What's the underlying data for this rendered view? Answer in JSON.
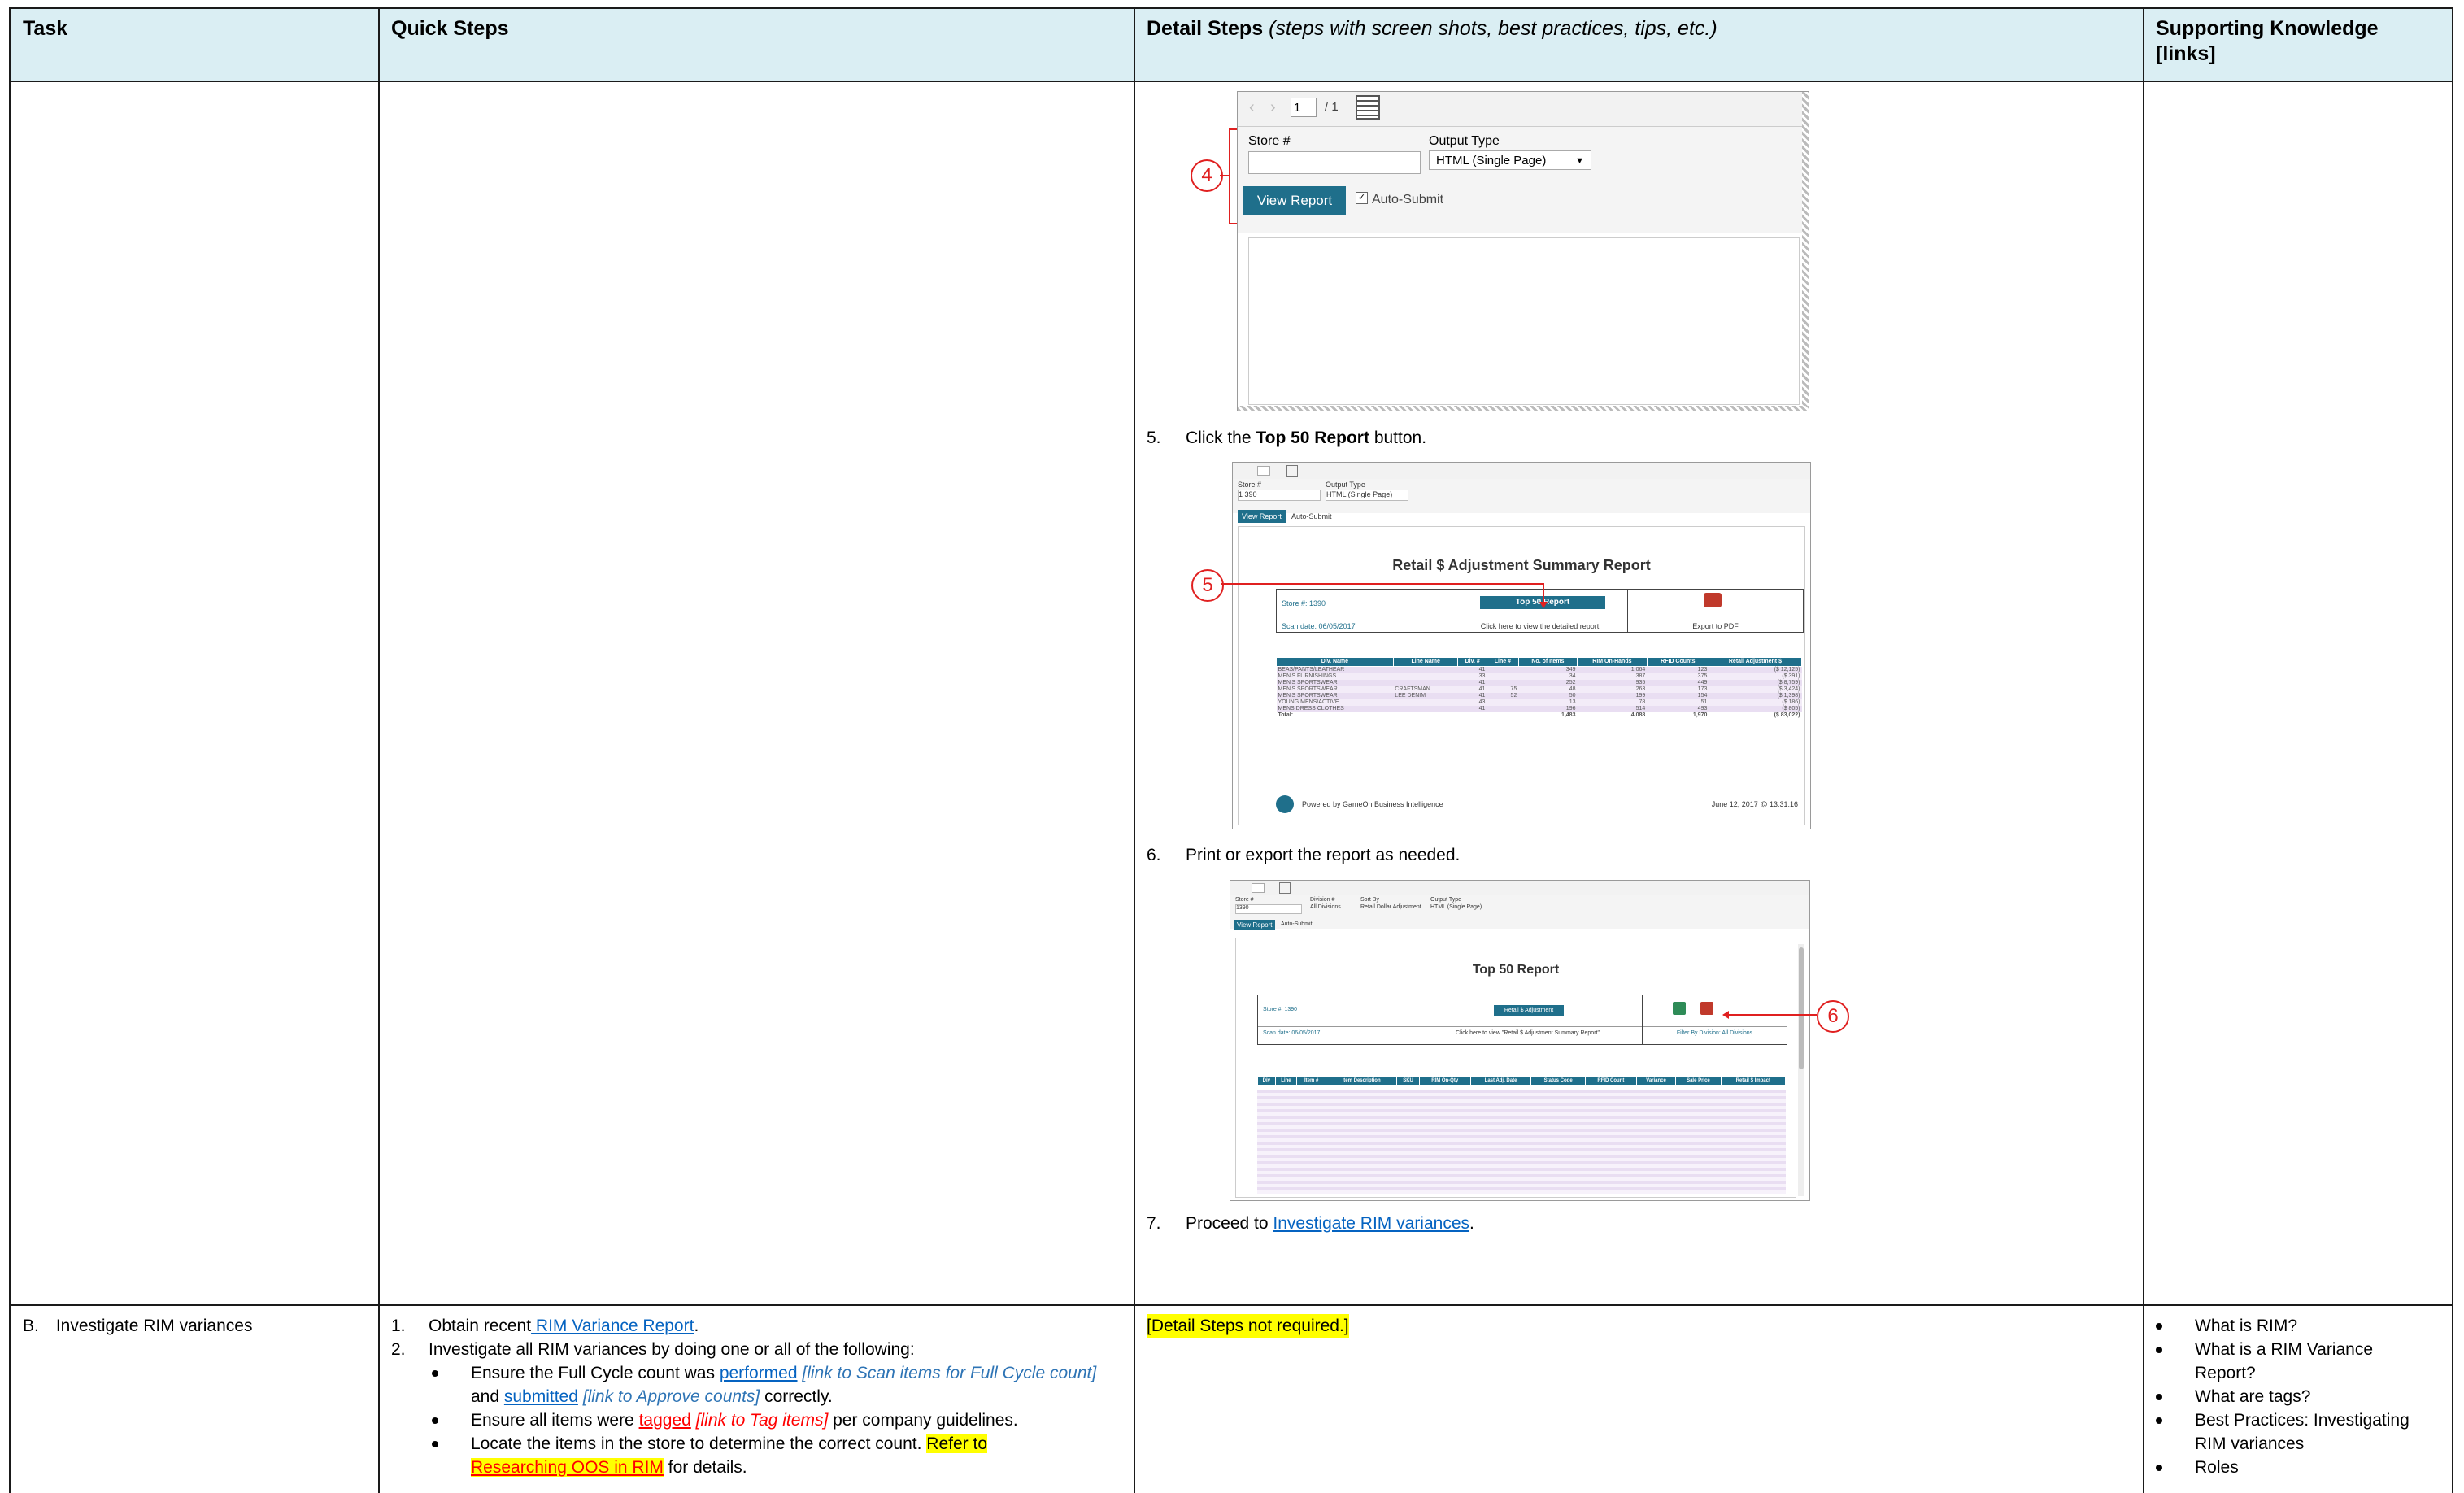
{
  "header": {
    "task": "Task",
    "quick_steps": "Quick Steps",
    "detail_steps": "Detail Steps",
    "detail_steps_note": "(steps with screen shots, best practices, tips, etc.)",
    "supporting_knowledge": "Supporting Knowledge",
    "supporting_links": "[links]"
  },
  "shot1": {
    "page_box": "1",
    "page_total": "/ 1",
    "store_label": "Store #",
    "output_label": "Output Type",
    "output_value": "HTML (Single Page)",
    "view_report": "View Report",
    "auto_submit": "Auto-Submit",
    "callout": "4"
  },
  "step5": {
    "num": "5.",
    "before": "Click the ",
    "bold": "Top 50 Report",
    "after": " button."
  },
  "shot2": {
    "store_label": "Store #",
    "store_value": "1 390",
    "output_label": "Output Type",
    "output_value": "HTML (Single Page)",
    "view_report": "View Report",
    "auto_submit": "Auto-Submit",
    "title": "Retail $ Adjustment Summary Report",
    "store_no": "Store #: 1390",
    "scan_date": "Scan date: 06/05/2017",
    "top50_button": "Top 50 Report",
    "click_text": "Click here to view the detailed report",
    "export_pdf": "Export to PDF",
    "columns": [
      "Div. Name",
      "Line Name",
      "Div. #",
      "Line #",
      "No. of Items",
      "RIM On-Hands",
      "RFID Counts",
      "Retail Adjustment $"
    ],
    "rows": [
      [
        "BEAS/PANTS/LEATHEAR",
        "",
        "41",
        "",
        "349",
        "1,064",
        "123",
        "($ 12,125)"
      ],
      [
        "MEN'S FURNISHINGS",
        "",
        "33",
        "",
        "34",
        "387",
        "375",
        "($ 391)"
      ],
      [
        "MEN'S SPORTSWEAR",
        "",
        "41",
        "",
        "252",
        "935",
        "449",
        "($ 8,759)"
      ],
      [
        "MEN'S SPORTSWEAR",
        "CRAFTSMAN",
        "41",
        "75",
        "48",
        "263",
        "173",
        "($ 3,424)"
      ],
      [
        "MEN'S SPORTSWEAR",
        "LEE DENIM",
        "41",
        "52",
        "50",
        "199",
        "154",
        "($ 1,398)"
      ],
      [
        "YOUNG MENS/ACTIVE",
        "",
        "43",
        "",
        "13",
        "78",
        "51",
        "($ 186)"
      ],
      [
        "MENS DRESS CLOTHES",
        "",
        "41",
        "",
        "196",
        "514",
        "493",
        "($ 805)"
      ]
    ],
    "total": [
      "Total:",
      "",
      "",
      "",
      "1,483",
      "4,088",
      "1,970",
      "($ 83,022)"
    ],
    "powered": "Powered by GameOn Business Intelligence",
    "timestamp": "June 12, 2017 @ 13:31:16",
    "callout": "5"
  },
  "step6": {
    "num": "6.",
    "text": "Print or export the report as needed."
  },
  "shot3": {
    "store_label": "Store #",
    "store_value": "1390",
    "division_label": "Division #",
    "division_value": "All Divisions",
    "sort_label": "Sort By",
    "sort_value": "Retail Dollar Adjustment",
    "output_label": "Output Type",
    "output_value": "HTML (Single Page)",
    "view_report": "View Report",
    "auto_submit": "Auto-Submit",
    "title": "Top 50 Report",
    "store_no": "Store #: 1390",
    "scan_date": "Scan date: 06/05/2017",
    "retail_button": "Retail $ Adjustment",
    "click_text": "Click here to view \"Retail $ Adjustment Summary Report\"",
    "filter_text": "Filter By Division: All Divisions",
    "columns": [
      "Div",
      "Line",
      "Item #",
      "Item Description",
      "SKU",
      "RIM On-Qty",
      "Last Adj. Date",
      "Status Code",
      "RFID Count",
      "Variance",
      "Sale Price",
      "Retail $ Impact"
    ],
    "callout": "6"
  },
  "step7": {
    "num": "7.",
    "before": "Proceed to ",
    "link": "Investigate RIM variances",
    "after": "."
  },
  "rowB": {
    "task": "B. Investigate RIM variances",
    "qs1_num": "1.",
    "qs1_before": "Obtain recent",
    "qs1_link": " RIM Variance Report",
    "qs1_after": ".",
    "qs2_num": "2.",
    "qs2": "Investigate all RIM variances by doing one or all of the following:",
    "b1_before": "Ensure the Full Cycle count was ",
    "b1_link": "performed",
    "b1_note": " [link to Scan items for Full Cycle count]",
    "b1_and": "and ",
    "b1_link2": "submitted",
    "b1_note2": " [link to Approve counts]",
    "b1_after": " correctly.",
    "b2_before": "Ensure all items were ",
    "b2_link": "tagged",
    "b2_note": " [link to Tag items]",
    "b2_after": " per company guidelines.",
    "b3_before": "Locate the items in the store to determine the correct count. ",
    "b3_hl": "Refer to",
    "b3_link": "Researching OOS in RIM",
    "b3_after": " for details.",
    "detail": "[Detail Steps not required.]",
    "support": [
      "What is RIM?",
      "What is a RIM Variance Report?",
      "What are tags?",
      "Best Practices: Investigating RIM variances",
      "Roles"
    ]
  }
}
